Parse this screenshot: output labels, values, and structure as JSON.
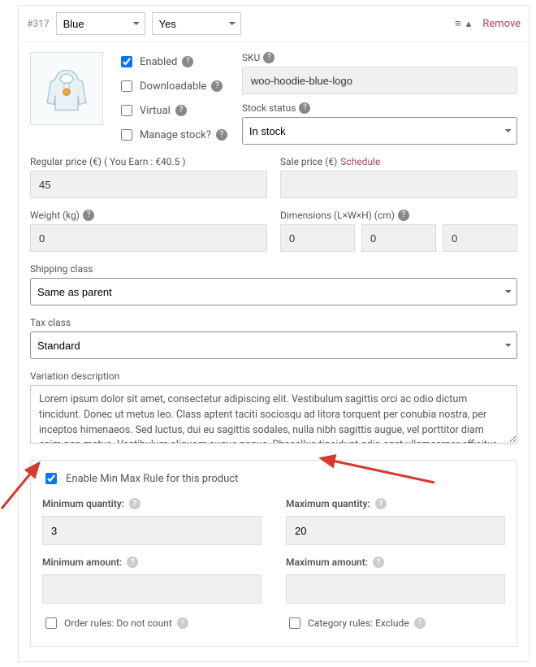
{
  "header": {
    "id": "#317",
    "attr1": "Blue",
    "attr2": "Yes",
    "remove": "Remove"
  },
  "checks": {
    "enabled": "Enabled",
    "downloadable": "Downloadable",
    "virtual": "Virtual",
    "manage_stock": "Manage stock?"
  },
  "sku": {
    "label": "SKU",
    "value": "woo-hoodie-blue-logo"
  },
  "stock": {
    "label": "Stock status",
    "value": "In stock"
  },
  "price": {
    "regular_label": "Regular price (€) ( You Earn : €40.5 )",
    "regular_value": "45",
    "sale_label": "Sale price (€)",
    "schedule": "Schedule",
    "sale_value": ""
  },
  "weight": {
    "label": "Weight (kg)",
    "value": "0"
  },
  "dims": {
    "label": "Dimensions (L×W×H) (cm)",
    "l": "0",
    "w": "0",
    "h": "0"
  },
  "shipping": {
    "label": "Shipping class",
    "value": "Same as parent"
  },
  "tax": {
    "label": "Tax class",
    "value": "Standard"
  },
  "desc": {
    "label": "Variation description",
    "value": "Lorem ipsum dolor sit amet, consectetur adipiscing elit. Vestibulum sagittis orci ac odio dictum tincidunt. Donec ut metus leo. Class aptent taciti sociosqu ad litora torquent per conubia nostra, per inceptos himenaeos. Sed luctus, dui eu sagittis sodales, nulla nibh sagittis augue, vel porttitor diam enim non metus. Vestibulum aliquam augue neque. Phasellus tincidunt odio eget ullamcorper efficitur. Cras placerat ut"
  },
  "minmax": {
    "enable": "Enable Min Max Rule for this product",
    "min_qty_label": "Minimum quantity:",
    "min_qty": "3",
    "max_qty_label": "Maximum quantity:",
    "max_qty": "20",
    "min_amt_label": "Minimum amount:",
    "min_amt": "",
    "max_amt_label": "Maximum amount:",
    "max_amt": "",
    "order_rules": "Order rules: Do not count",
    "category_rules": "Category rules: Exclude"
  }
}
